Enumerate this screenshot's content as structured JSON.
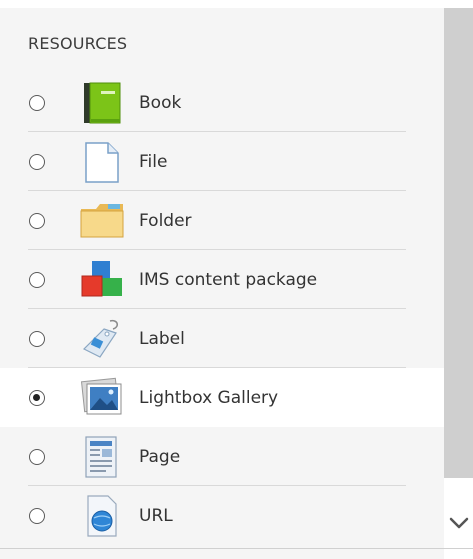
{
  "section": {
    "title": "RESOURCES"
  },
  "items": [
    {
      "label": "Book",
      "icon": "book-icon",
      "selected": false
    },
    {
      "label": "File",
      "icon": "file-icon",
      "selected": false
    },
    {
      "label": "Folder",
      "icon": "folder-icon",
      "selected": false
    },
    {
      "label": "IMS content package",
      "icon": "ims-package-icon",
      "selected": false
    },
    {
      "label": "Label",
      "icon": "label-tag-icon",
      "selected": false
    },
    {
      "label": "Lightbox Gallery",
      "icon": "gallery-icon",
      "selected": true
    },
    {
      "label": "Page",
      "icon": "page-icon",
      "selected": false
    },
    {
      "label": "URL",
      "icon": "url-globe-icon",
      "selected": false
    }
  ],
  "colors": {
    "panel_bg": "#f5f5f5",
    "selected_bg": "#ffffff",
    "scrollbar": "#cfcfcf"
  }
}
